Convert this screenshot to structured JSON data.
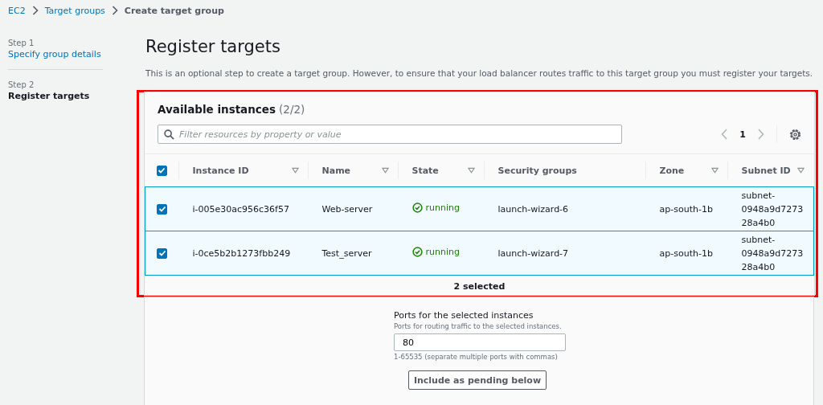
{
  "breadcrumb": [
    {
      "label": "EC2",
      "link": true
    },
    {
      "label": "Target groups",
      "link": true
    },
    {
      "label": "Create target group",
      "link": false
    }
  ],
  "steps": [
    {
      "step": "Step 1",
      "label": "Specify group details",
      "selected": false
    },
    {
      "step": "Step 2",
      "label": "Register targets",
      "selected": true
    }
  ],
  "page": {
    "title": "Register targets",
    "description": "This is an optional step to create a target group. However, to ensure that your load balancer routes traffic to this target group you must register your targets."
  },
  "instances": {
    "title": "Available instances",
    "count": "(2/2)",
    "search": {
      "placeholder": "Filter resources by property or value"
    },
    "page": "1",
    "all_checked": true,
    "columns": [
      {
        "label": "Instance ID",
        "sortable": true
      },
      {
        "label": "Name",
        "sortable": true
      },
      {
        "label": "State",
        "sortable": true
      },
      {
        "label": "Security groups",
        "sortable": false
      },
      {
        "label": "Zone",
        "sortable": true
      },
      {
        "label": "Subnet ID",
        "sortable": true
      }
    ],
    "rows": [
      {
        "selected": true,
        "instance_id": "i-005e30ac956c36f57",
        "name": "Web-server",
        "state": "running",
        "color": "#1d8102",
        "security_group": "launch-wizard-6",
        "zone": "ap-south-1b",
        "subnet_id": [
          "subnet-",
          "0948a9d7273",
          "28a4b0"
        ]
      },
      {
        "selected": true,
        "instance_id": "i-0ce5b2b1273fbb249",
        "name": "Test_server",
        "state": "running",
        "color": "#1d8102",
        "security_group": "launch-wizard-7",
        "zone": "ap-south-1b",
        "subnet_id": [
          "subnet-",
          "0948a9d7273",
          "28a4b0"
        ]
      }
    ],
    "footer": "2 selected"
  },
  "ports": {
    "label": "Ports for the selected instances",
    "description": "Ports for routing traffic to the selected instances.",
    "value": "80",
    "hint": "1-65535 (separate multiple ports with commas)",
    "button": "Include as pending below"
  }
}
